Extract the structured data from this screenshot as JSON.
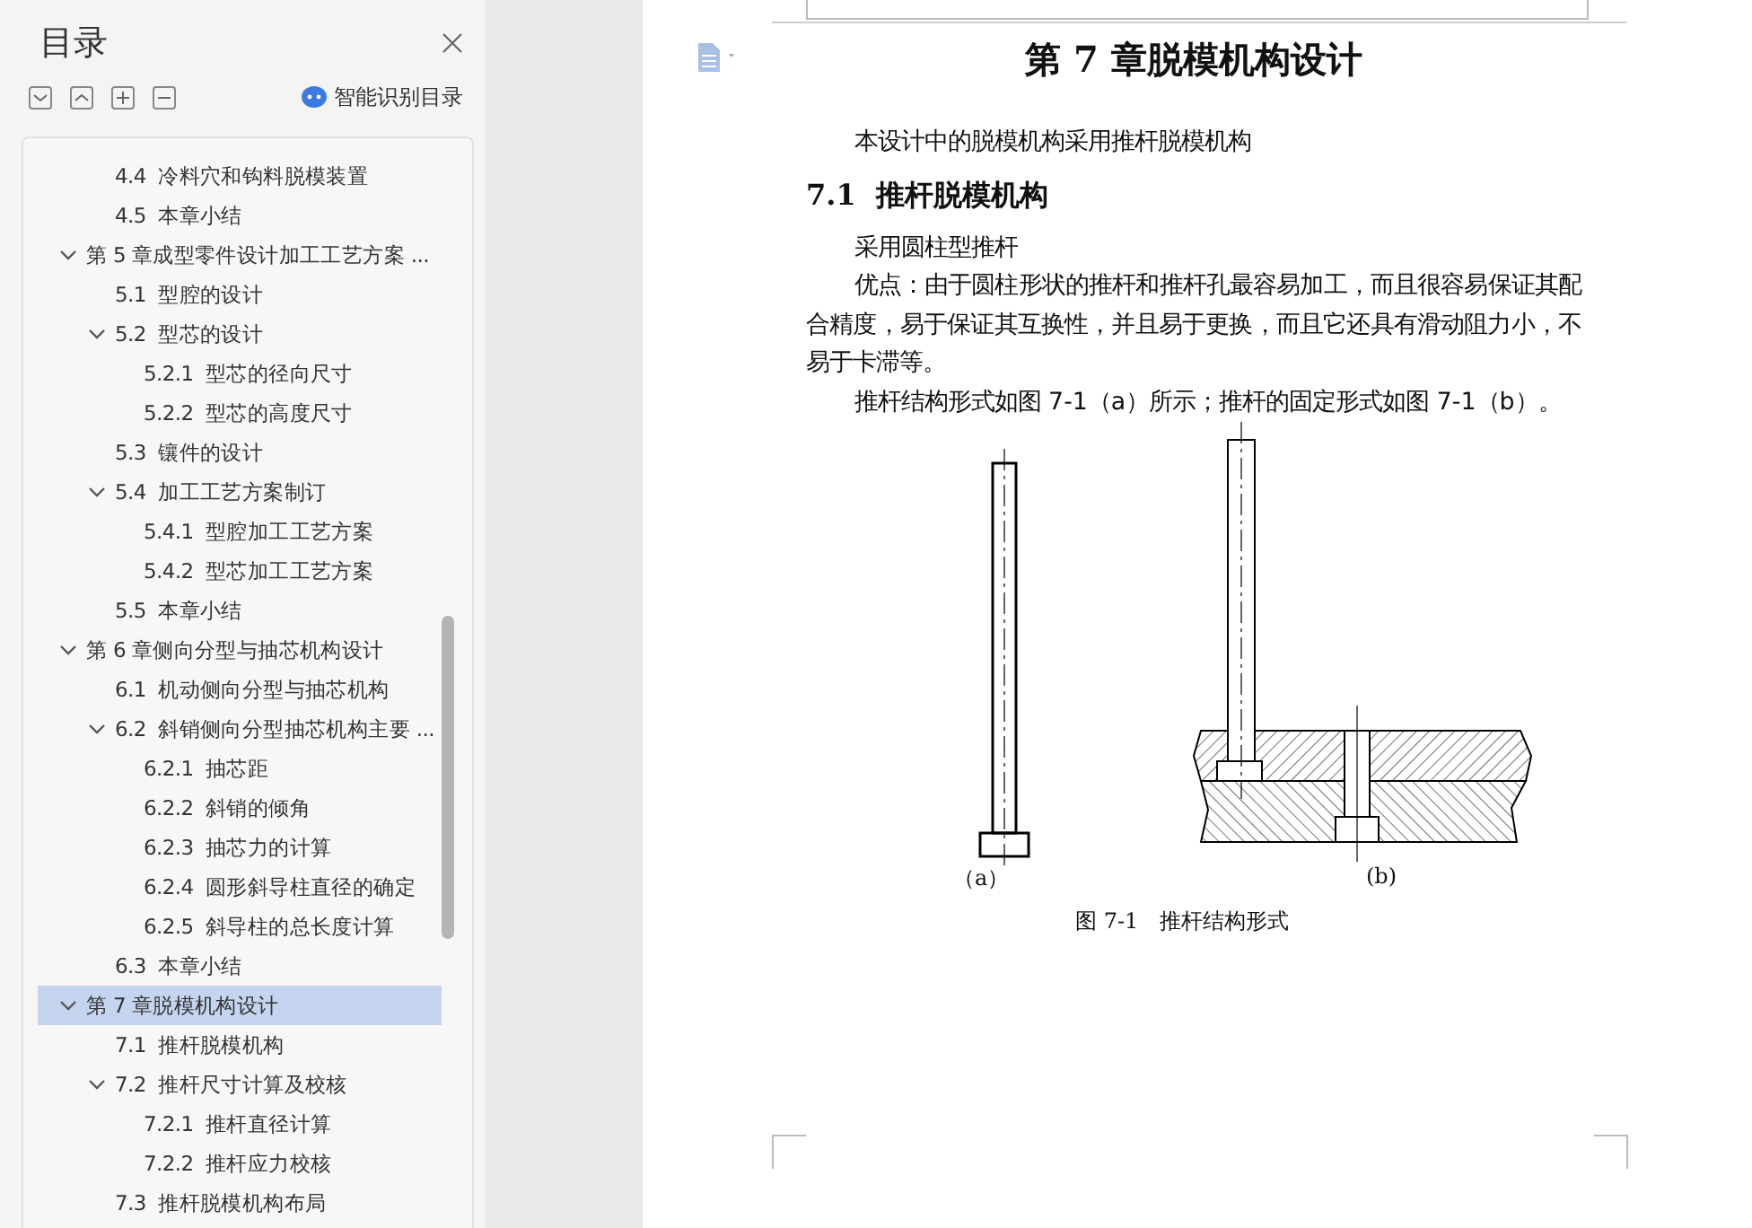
{
  "panel": {
    "title": "目录",
    "smart_button": "智能识别目录"
  },
  "toc": {
    "continued_items": [
      {
        "label": "4.4  冷料穴和钩料脱模装置",
        "selected": false
      },
      {
        "label": "4.5  本章小结",
        "selected": false
      }
    ],
    "items": [
      {
        "label": "第 5 章成型零件设计加工工艺方案 ...",
        "selected": false,
        "expanded": true,
        "children": [
          {
            "label": "5.1  型腔的设计",
            "selected": false
          },
          {
            "label": "5.2  型芯的设计",
            "selected": false,
            "expanded": true,
            "children": [
              {
                "label": "5.2.1  型芯的径向尺寸",
                "selected": false
              },
              {
                "label": "5.2.2  型芯的高度尺寸",
                "selected": false
              }
            ]
          },
          {
            "label": "5.3  镶件的设计",
            "selected": false
          },
          {
            "label": "5.4  加工工艺方案制订",
            "selected": false,
            "expanded": true,
            "children": [
              {
                "label": "5.4.1  型腔加工工艺方案",
                "selected": false
              },
              {
                "label": "5.4.2  型芯加工工艺方案",
                "selected": false
              }
            ]
          },
          {
            "label": "5.5  本章小结",
            "selected": false
          }
        ]
      },
      {
        "label": "第 6 章侧向分型与抽芯机构设计",
        "selected": false,
        "expanded": true,
        "children": [
          {
            "label": "6.1  机动侧向分型与抽芯机构",
            "selected": false
          },
          {
            "label": "6.2  斜销侧向分型抽芯机构主要 ...",
            "selected": false,
            "expanded": true,
            "children": [
              {
                "label": "6.2.1  抽芯距",
                "selected": false
              },
              {
                "label": "6.2.2  斜销的倾角",
                "selected": false
              },
              {
                "label": "6.2.3  抽芯力的计算",
                "selected": false
              },
              {
                "label": "6.2.4  圆形斜导柱直径的确定",
                "selected": false
              },
              {
                "label": "6.2.5  斜导柱的总长度计算",
                "selected": false
              }
            ]
          },
          {
            "label": "6.3  本章小结",
            "selected": false
          }
        ]
      },
      {
        "label": "第 7 章脱模机构设计",
        "selected": true,
        "expanded": true,
        "children": [
          {
            "label": "7.1  推杆脱模机构",
            "selected": false
          },
          {
            "label": "7.2  推杆尺寸计算及校核",
            "selected": false,
            "expanded": true,
            "children": [
              {
                "label": "7.2.1  推杆直径计算",
                "selected": false
              },
              {
                "label": "7.2.2  推杆应力校核",
                "selected": false
              }
            ]
          },
          {
            "label": "7.3  推杆脱模机构布局",
            "selected": false
          }
        ]
      }
    ]
  },
  "document": {
    "chapter_title": "第 7 章脱模机构设计",
    "blocks": [
      {
        "kind": "paragraph",
        "text": "本设计中的脱模机构采用推杆脱模机构"
      },
      {
        "kind": "heading",
        "text": "7.1  推杆脱模机构"
      },
      {
        "kind": "paragraph",
        "text": "采用圆柱型推杆"
      },
      {
        "kind": "paragraph",
        "text": "优点：由于圆柱形状的推杆和推杆孔最容易加工，而且很容易保证其配合精度，易于保证其互换性，并且易于更换，而且它还具有滑动阻力小，不易于卡滞等。"
      },
      {
        "kind": "paragraph",
        "text": "推杆结构形式如图 7-1（a）所示；推杆的固定形式如图 7-1（b）。"
      }
    ],
    "figure": {
      "labels": [
        "（a）",
        "(b)"
      ],
      "caption": "图 7-1　推杆结构形式"
    }
  }
}
